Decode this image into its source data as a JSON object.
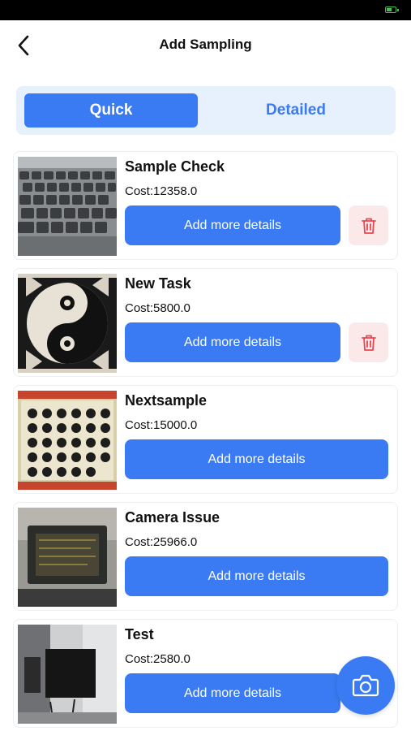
{
  "header": {
    "title": "Add Sampling",
    "back_icon": "chevron-left-icon"
  },
  "tabs": [
    {
      "label": "Quick",
      "selected": true
    },
    {
      "label": "Detailed",
      "selected": false
    }
  ],
  "samples": [
    {
      "title": "Sample Check",
      "cost": "Cost:12358.0",
      "action_label": "Add more details",
      "deletable": true,
      "image": "keyboard photo"
    },
    {
      "title": "New Task",
      "cost": "Cost:5800.0",
      "action_label": "Add more details",
      "deletable": true,
      "image": "yin-yang cloth photo"
    },
    {
      "title": "Nextsample",
      "cost": "Cost:15000.0",
      "action_label": "Add more details",
      "deletable": false,
      "image": "sticker sheet photo"
    },
    {
      "title": "Camera Issue",
      "cost": "Cost:25966.0",
      "action_label": "Add more details",
      "deletable": false,
      "image": "device photo"
    },
    {
      "title": "Test",
      "cost": "Cost:2580.0",
      "action_label": "Add more details",
      "deletable": false,
      "image": "room photo"
    }
  ],
  "fab_icon": "camera-icon",
  "colors": {
    "accent": "#3a7bf3",
    "tab_bg": "#e6f1fd",
    "delete_bg": "#fbe9ea",
    "delete_icon": "#e8474f"
  }
}
